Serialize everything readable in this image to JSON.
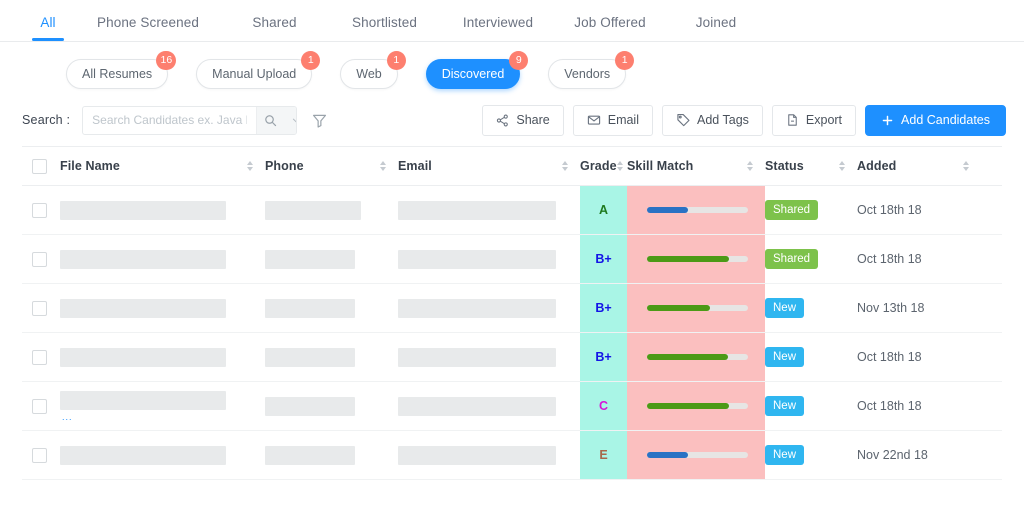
{
  "tabs": [
    {
      "label": "All",
      "active": true
    },
    {
      "label": "Phone Screened",
      "active": false
    },
    {
      "label": "Shared",
      "active": false
    },
    {
      "label": "Shortlisted",
      "active": false
    },
    {
      "label": "Interviewed",
      "active": false
    },
    {
      "label": "Job Offered",
      "active": false
    },
    {
      "label": "Joined",
      "active": false
    }
  ],
  "chips": [
    {
      "label": "All Resumes",
      "badge": "16",
      "active": false
    },
    {
      "label": "Manual Upload",
      "badge": "1",
      "active": false
    },
    {
      "label": "Web",
      "badge": "1",
      "active": false
    },
    {
      "label": "Discovered",
      "badge": "9",
      "active": true
    },
    {
      "label": "Vendors",
      "badge": "1",
      "active": false
    }
  ],
  "toolbar": {
    "search_label": "Search :",
    "search_value": "",
    "search_placeholder": "Search Candidates ex. Java Develop",
    "search_icon": "search-icon",
    "dropdown_icon": "chevron-down-icon",
    "filter_icon": "funnel-filter-icon",
    "buttons": [
      {
        "label": "Share",
        "icon": "share-icon"
      },
      {
        "label": "Email",
        "icon": "envelope-icon"
      },
      {
        "label": "Add Tags",
        "icon": "tag-icon"
      },
      {
        "label": "Export",
        "icon": "document-icon"
      }
    ],
    "primary_button": {
      "label": "Add Candidates",
      "icon": "plus-icon"
    }
  },
  "table": {
    "columns": [
      {
        "key": "file",
        "label": "File Name",
        "sortable": true
      },
      {
        "key": "phone",
        "label": "Phone",
        "sortable": true
      },
      {
        "key": "email",
        "label": "Email",
        "sortable": true
      },
      {
        "key": "grade",
        "label": "Grade",
        "sortable": true
      },
      {
        "key": "skill",
        "label": "Skill Match",
        "sortable": true
      },
      {
        "key": "status",
        "label": "Status",
        "sortable": true
      },
      {
        "key": "added",
        "label": "Added",
        "sortable": true
      }
    ],
    "rows": [
      {
        "file_redacted": true,
        "phone_redacted": true,
        "email_redacted": true,
        "has_dots": false,
        "grade": "A",
        "grade_color": "#1f7a1f",
        "skill_percent": 41,
        "skill_color": "#2a72c4",
        "status": "Shared",
        "status_color": "#7dc24b",
        "added": "Oct 18th 18"
      },
      {
        "file_redacted": true,
        "phone_redacted": true,
        "email_redacted": true,
        "has_dots": false,
        "grade": "B+",
        "grade_color": "#1414e6",
        "skill_percent": 81,
        "skill_color": "#4b9a16",
        "status": "Shared",
        "status_color": "#7dc24b",
        "added": "Oct 18th 18"
      },
      {
        "file_redacted": true,
        "phone_redacted": true,
        "email_redacted": true,
        "has_dots": false,
        "grade": "B+",
        "grade_color": "#1414e6",
        "skill_percent": 62,
        "skill_color": "#4b9a16",
        "status": "New",
        "status_color": "#2fb6f0",
        "added": "Nov 13th 18"
      },
      {
        "file_redacted": true,
        "phone_redacted": true,
        "email_redacted": true,
        "has_dots": false,
        "grade": "B+",
        "grade_color": "#1414e6",
        "skill_percent": 80,
        "skill_color": "#4b9a16",
        "status": "New",
        "status_color": "#2fb6f0",
        "added": "Oct 18th 18"
      },
      {
        "file_redacted": true,
        "phone_redacted": true,
        "email_redacted": true,
        "has_dots": true,
        "dots": "...",
        "grade": "C",
        "grade_color": "#d616d6",
        "skill_percent": 81,
        "skill_color": "#4b9a16",
        "status": "New",
        "status_color": "#2fb6f0",
        "added": "Oct 18th 18"
      },
      {
        "file_redacted": true,
        "phone_redacted": true,
        "email_redacted": true,
        "has_dots": false,
        "grade": "E",
        "grade_color": "#a8694a",
        "skill_percent": 41,
        "skill_color": "#2a72c4",
        "status": "New",
        "status_color": "#2fb6f0",
        "added": "Nov 22nd 18"
      }
    ],
    "highlight": {
      "grade_column_color": "#a9f5e6",
      "skill_column_color": "#fbbfbf"
    },
    "select_all_checked": false
  },
  "colors": {
    "accent": "#1e90ff",
    "badge": "#fd7f6f",
    "shared": "#7dc24b",
    "new": "#2fb6f0"
  }
}
